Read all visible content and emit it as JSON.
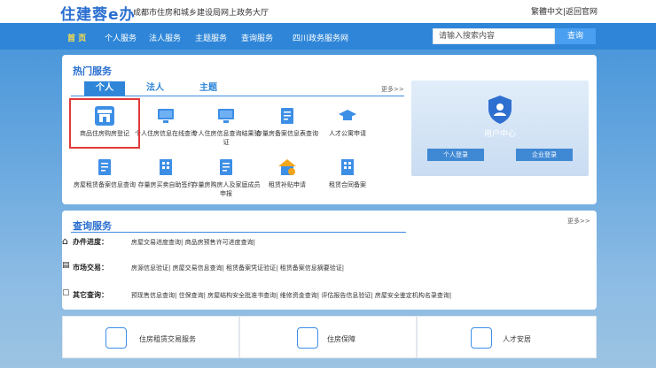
{
  "header": {
    "logo": "住建蓉e办",
    "subtitle": "成都市住房和城乡建设局网上政务大厅",
    "links": "繁體中文|返回官网"
  },
  "nav": {
    "items": [
      "首  页",
      "个人服务",
      "法人服务",
      "主题服务",
      "查询服务",
      "四川政务服务网"
    ],
    "search_placeholder": "请输入搜索内容",
    "search_button": "查询"
  },
  "hot": {
    "title": "热门服务",
    "tabs": [
      "个人",
      "法人",
      "主题"
    ],
    "more": "更多>>",
    "items": [
      {
        "label": "商品住房购房登记",
        "icon": "shop-icon"
      },
      {
        "label": "个人住房信息在线查询",
        "icon": "monitor-icon"
      },
      {
        "label": "个人住房信息查询结果验证",
        "icon": "monitor-icon"
      },
      {
        "label": "存量房备案信息表查询",
        "icon": "document-icon"
      },
      {
        "label": "人才公寓申请",
        "icon": "graduation-cap-icon"
      },
      {
        "label": "房屋租赁备案信息查询",
        "icon": "document-icon"
      },
      {
        "label": "存量房买卖自助签约",
        "icon": "building-icon"
      },
      {
        "label": "存量房购房人及家庭成员申报",
        "icon": "document-icon"
      },
      {
        "label": "租赁补贴申请",
        "icon": "house-icon"
      },
      {
        "label": "租赁合同备案",
        "icon": "building-icon"
      }
    ]
  },
  "user_center": {
    "title": "用户中心",
    "personal_login": "个人登录",
    "enterprise_login": "企业登录"
  },
  "query": {
    "title": "查询服务",
    "more": "更多>>",
    "rows": [
      {
        "label": "办件进度：",
        "links": "房屋交易进度查询| 商品房预售许可进度查询|"
      },
      {
        "label": "市场交易：",
        "links": "房源信息验证| 房屋交易信息查询| 租赁备案凭证验证| 租赁备案信息摘要验证|"
      },
      {
        "label": "其它查询：",
        "links": "预现售信息查询| 住保查询| 房屋结构安全批准书查询| 维修资金查询| 评估报告信息验证| 房屋安全鉴定机构名录查询|"
      }
    ]
  },
  "bottom": [
    "住房租赁交易服务",
    "住房保障",
    "人才安居"
  ],
  "colors": {
    "brand": "#2f86d8",
    "highlight": "#e03a3a"
  }
}
